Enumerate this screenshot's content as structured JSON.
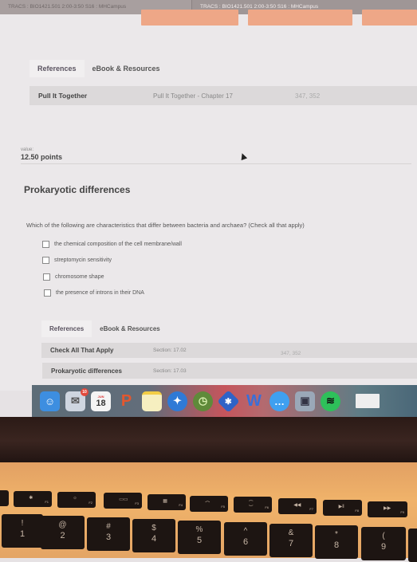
{
  "browser": {
    "tabs": [
      {
        "title": "TRACS : BIO1421.501 2:00-3:50 S16 : MHCampus",
        "active": false
      },
      {
        "title": "TRACS : BIO1421.501 2:00-3:50 S16 : MHCampus",
        "active": true
      }
    ]
  },
  "top_references": {
    "tabs": [
      "References",
      "eBook & Resources"
    ],
    "rows": [
      {
        "name": "Pull It Together",
        "detail": "Pull It Together - Chapter 17",
        "pages": "347, 352"
      }
    ]
  },
  "question": {
    "value_label": "value:",
    "points": "12.50 points",
    "title": "Prokaryotic differences",
    "prompt": "Which of the following are characteristics that differ between bacteria and archaea? (Check all that apply)",
    "options": [
      {
        "label": "the chemical composition of the cell membrane/wall",
        "checked": false
      },
      {
        "label": "streptomycin sensitivity",
        "checked": false
      },
      {
        "label": "chromosome shape",
        "checked": false
      },
      {
        "label": "the presence of introns in their DNA",
        "checked": false
      }
    ]
  },
  "bottom_references": {
    "tabs": [
      "References",
      "eBook & Resources"
    ],
    "rows": [
      {
        "name": "Check All That Apply",
        "section": "Section: 17.02",
        "pages": "347, 352"
      },
      {
        "name": "Prokaryotic differences",
        "section": "Section: 17.03",
        "pages": ""
      }
    ]
  },
  "dock": {
    "items": [
      {
        "name": "finder",
        "glyph": "☺",
        "color": "#3d8ee0"
      },
      {
        "name": "mail",
        "glyph": "✉",
        "color": "#cfd6e0",
        "badge": "10"
      },
      {
        "name": "calendar",
        "glyph": "18",
        "color": "#f4f4f4",
        "month": "JUN"
      },
      {
        "name": "powerpoint",
        "glyph": "P",
        "color": "#e4572e"
      },
      {
        "name": "notes",
        "glyph": "",
        "color": "#f6efc0"
      },
      {
        "name": "safari",
        "glyph": "✦",
        "color": "#2f7ad6"
      },
      {
        "name": "time-machine",
        "glyph": "◷",
        "color": "#5f8a3a"
      },
      {
        "name": "bluetooth",
        "glyph": "✱",
        "color": "#2f63c7"
      },
      {
        "name": "word",
        "glyph": "W",
        "color": "#3a6fd8"
      },
      {
        "name": "messages",
        "glyph": "…",
        "color": "#3fa0f0"
      },
      {
        "name": "preview",
        "glyph": "▣",
        "color": "#9aa8b8"
      },
      {
        "name": "spotify",
        "glyph": "≋",
        "color": "#2ec05a"
      },
      {
        "name": "blank-window",
        "glyph": "",
        "color": "#eeeeee"
      }
    ]
  },
  "keyboard": {
    "function_keys": [
      {
        "icon": "✱",
        "label": "F1"
      },
      {
        "icon": "☼",
        "label": "F2"
      },
      {
        "icon": "▭▭",
        "label": "F3"
      },
      {
        "icon": "▦",
        "label": "F4"
      },
      {
        "icon": "⌒",
        "label": "F5"
      },
      {
        "icon": "⁐",
        "label": "F6"
      },
      {
        "icon": "◀◀",
        "label": "F7"
      },
      {
        "icon": "▶ǁ",
        "label": "F8"
      },
      {
        "icon": "▶▶",
        "label": "F9"
      }
    ],
    "number_keys": [
      {
        "top": "!",
        "bottom": "1"
      },
      {
        "top": "@",
        "bottom": "2"
      },
      {
        "top": "#",
        "bottom": "3"
      },
      {
        "top": "$",
        "bottom": "4"
      },
      {
        "top": "%",
        "bottom": "5"
      },
      {
        "top": "^",
        "bottom": "6"
      },
      {
        "top": "&",
        "bottom": "7"
      },
      {
        "top": "*",
        "bottom": "8"
      },
      {
        "top": "(",
        "bottom": "9"
      }
    ]
  }
}
